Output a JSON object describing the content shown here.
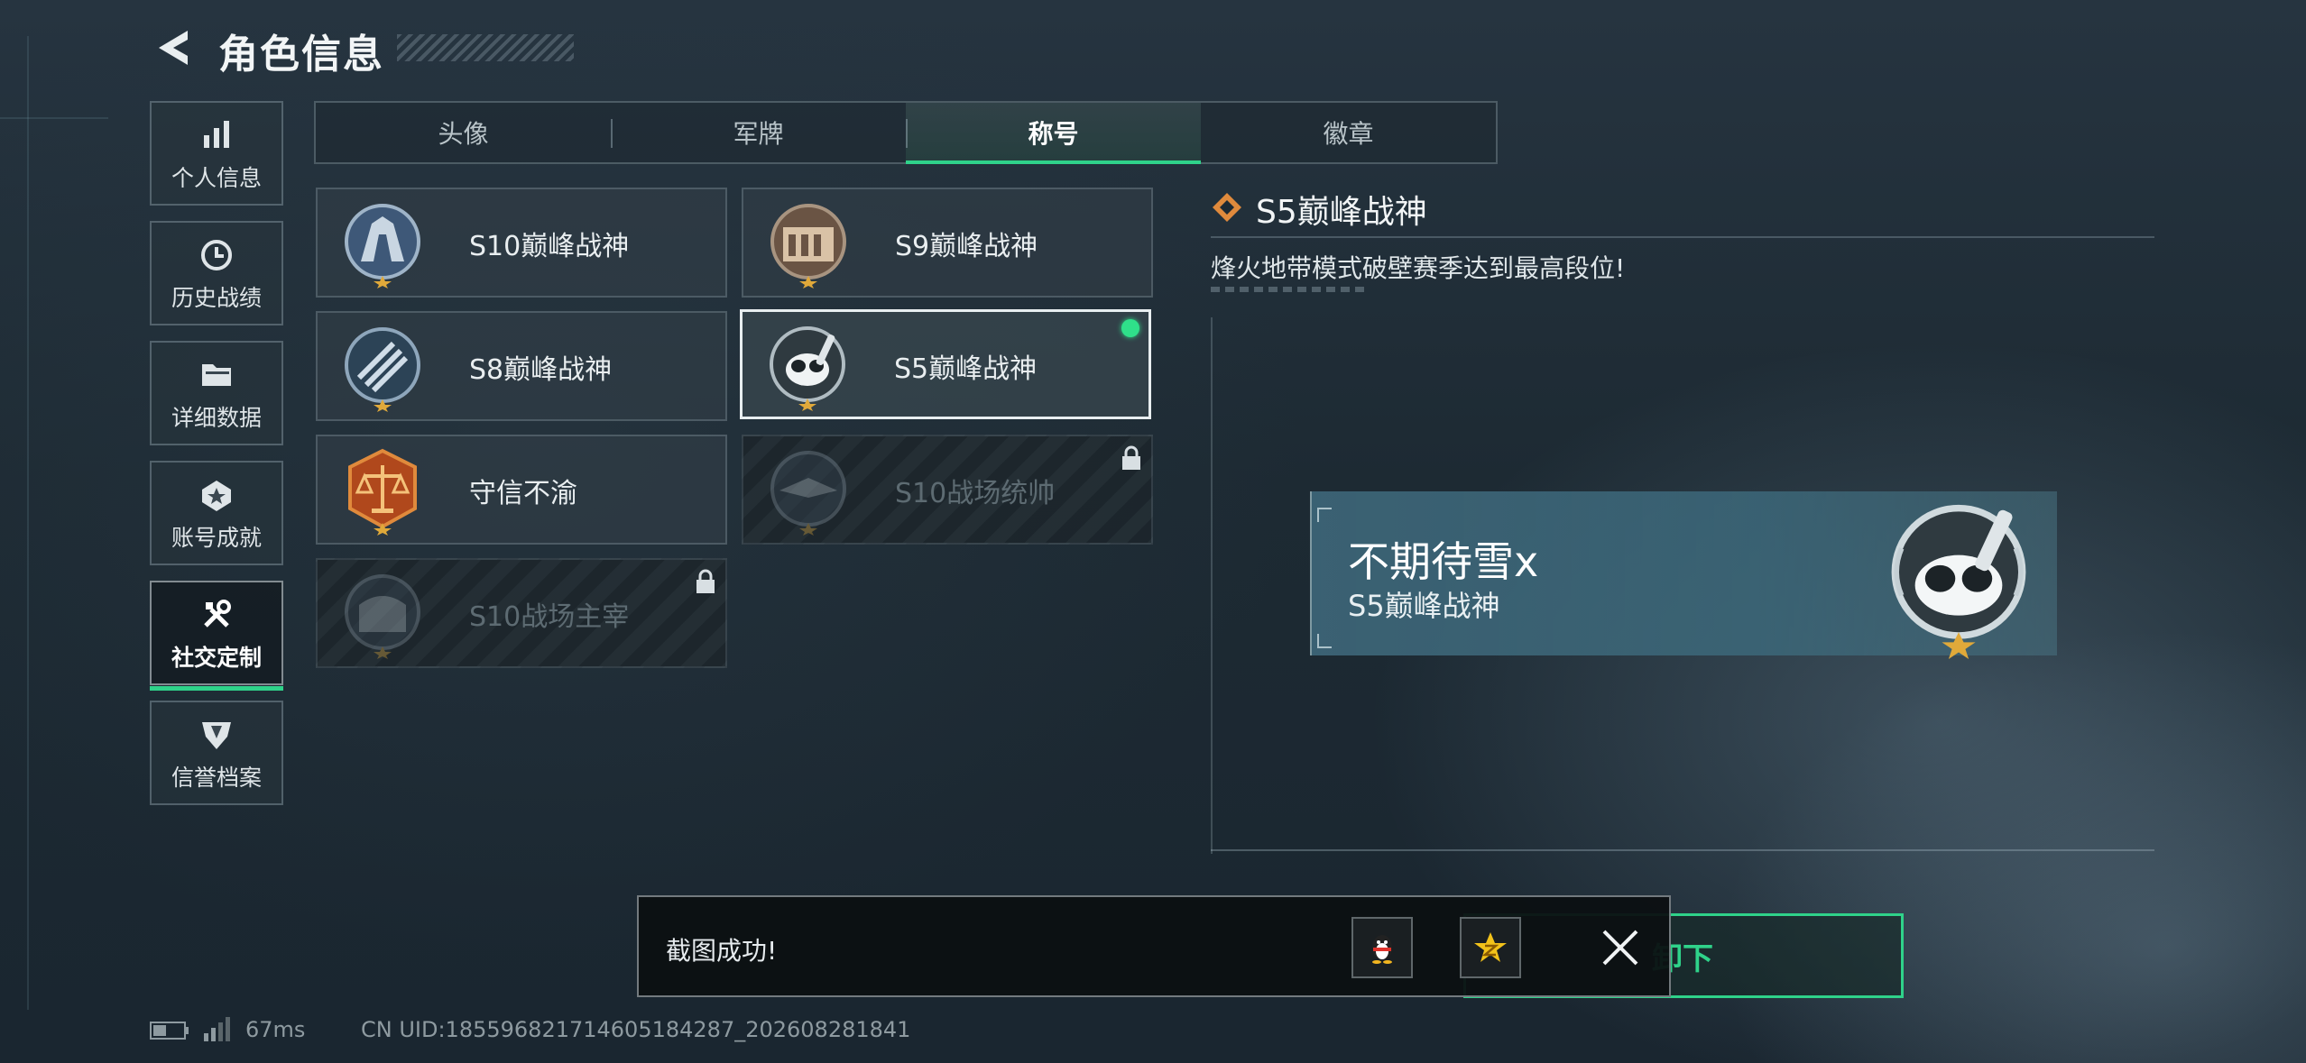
{
  "header": {
    "title": "角色信息"
  },
  "sidebar": {
    "items": [
      {
        "label": "个人信息",
        "icon": "bar-chart-icon"
      },
      {
        "label": "历史战绩",
        "icon": "history-clock-icon"
      },
      {
        "label": "详细数据",
        "icon": "folder-icon"
      },
      {
        "label": "账号成就",
        "icon": "achievement-medal-icon"
      },
      {
        "label": "社交定制",
        "icon": "tools-icon",
        "active": true
      },
      {
        "label": "信誉档案",
        "icon": "reputation-shield-icon"
      }
    ]
  },
  "tabs": [
    {
      "label": "头像"
    },
    {
      "label": "军牌"
    },
    {
      "label": "称号",
      "active": true
    },
    {
      "label": "徽章"
    }
  ],
  "titles": [
    {
      "name": "S10巅峰战神",
      "locked": false,
      "emblem": "s10-peak-emblem"
    },
    {
      "name": "S9巅峰战神",
      "locked": false,
      "emblem": "s9-peak-emblem"
    },
    {
      "name": "S8巅峰战神",
      "locked": false,
      "emblem": "s8-peak-emblem"
    },
    {
      "name": "S5巅峰战神",
      "locked": false,
      "selected": true,
      "equipped": true,
      "emblem": "s5-peak-emblem"
    },
    {
      "name": "守信不渝",
      "locked": false,
      "emblem": "scales-emblem"
    },
    {
      "name": "S10战场统帅",
      "locked": true,
      "emblem": "s10-commander-emblem"
    },
    {
      "name": "S10战场主宰",
      "locked": true,
      "emblem": "s10-dominator-emblem"
    }
  ],
  "detail": {
    "title": "S5巅峰战神",
    "description": "烽火地带模式破壁赛季达到最高段位!"
  },
  "preview": {
    "player_name": "不期待雪x",
    "title": "S5巅峰战神"
  },
  "action_button": {
    "label": "卸下"
  },
  "toast": {
    "message": "截图成功!"
  },
  "footer": {
    "ping": "67ms",
    "uid": "CN UID:1855968217146051842​87_202608281841"
  },
  "colors": {
    "accent": "#2fd28a",
    "equipped_dot": "#2fe08a",
    "nameplate": "#3c6476"
  }
}
